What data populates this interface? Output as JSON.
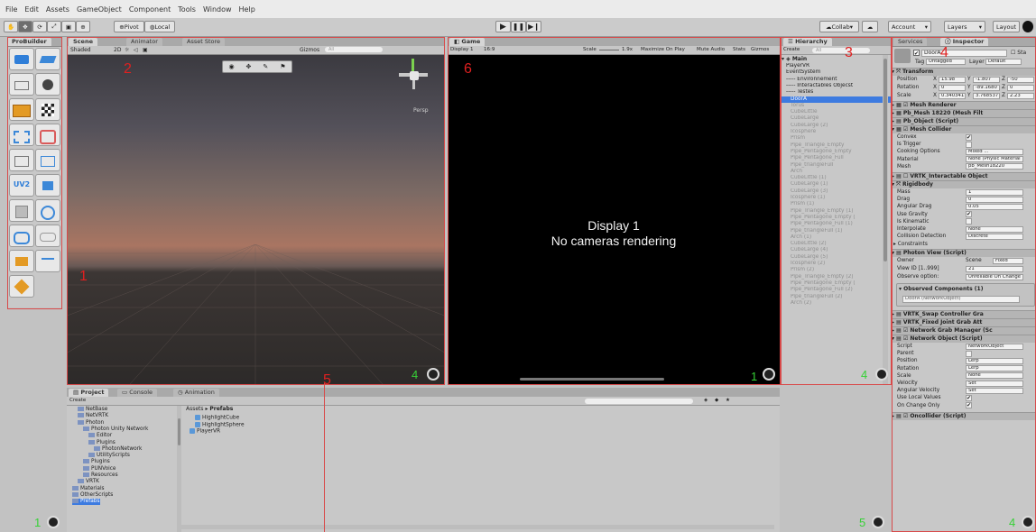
{
  "menu": [
    "File",
    "Edit",
    "Assets",
    "GameObject",
    "Component",
    "Tools",
    "Window",
    "Help"
  ],
  "toolbar": {
    "pivot": "Pivot",
    "local": "Local",
    "collab": "Collab",
    "account": "Account",
    "layers": "Layers",
    "layout": "Layout"
  },
  "probuilder": {
    "tab": "ProBuilder"
  },
  "scene": {
    "tabs": [
      "Scene",
      "Animator",
      "Asset Store"
    ],
    "shading": "Shaded",
    "mode2d": "2D",
    "gizmos": "Gizmos",
    "search": "All",
    "persp": "Persp"
  },
  "game": {
    "tab": "Game",
    "display": "Display 1",
    "aspect": "16:9",
    "scale_label": "Scale",
    "scale_value": "1.9x",
    "maximize": "Maximize On Play",
    "mute": "Mute Audio",
    "stats": "Stats",
    "gizmos": "Gizmos",
    "message_line1": "Display 1",
    "message_line2": "No cameras rendering"
  },
  "hierarchy": {
    "tab": "Hierarchy",
    "create": "Create",
    "search": "All",
    "scene": "Main",
    "items": [
      {
        "label": "PlayerVR",
        "indent": 1,
        "dim": false
      },
      {
        "label": "EventSystem",
        "indent": 1,
        "dim": false
      },
      {
        "label": "----- Environnement",
        "indent": 1,
        "dim": false
      },
      {
        "label": "----- Interactables Objecst",
        "indent": 1,
        "dim": false
      },
      {
        "label": "----- Testes",
        "indent": 1,
        "dim": false
      },
      {
        "label": "DoorA",
        "indent": 2,
        "dim": false,
        "selected": true
      },
      {
        "label": "Torus",
        "indent": 2,
        "dim": true
      },
      {
        "label": "CubeLittle",
        "indent": 2,
        "dim": true
      },
      {
        "label": "CubeLarge",
        "indent": 2,
        "dim": true
      },
      {
        "label": "CubeLarge (2)",
        "indent": 2,
        "dim": true
      },
      {
        "label": "Icosphere",
        "indent": 2,
        "dim": true
      },
      {
        "label": "Prism",
        "indent": 2,
        "dim": true
      },
      {
        "label": "Pipe_Triangle_Empty",
        "indent": 2,
        "dim": true
      },
      {
        "label": "Pipe_Pentagone_Empty",
        "indent": 2,
        "dim": true
      },
      {
        "label": "Pipe_Pentagone_Full",
        "indent": 2,
        "dim": true
      },
      {
        "label": "Pipe_triangleFull",
        "indent": 2,
        "dim": true
      },
      {
        "label": "Arch",
        "indent": 2,
        "dim": true
      },
      {
        "label": "CubeLittle (1)",
        "indent": 2,
        "dim": true
      },
      {
        "label": "CubeLarge (1)",
        "indent": 2,
        "dim": true
      },
      {
        "label": "CubeLarge (3)",
        "indent": 2,
        "dim": true
      },
      {
        "label": "Icosphere (1)",
        "indent": 2,
        "dim": true
      },
      {
        "label": "Prism (1)",
        "indent": 2,
        "dim": true
      },
      {
        "label": "Pipe_Triangle_Empty (1)",
        "indent": 2,
        "dim": true
      },
      {
        "label": "Pipe_Pentagone_Empty (",
        "indent": 2,
        "dim": true
      },
      {
        "label": "Pipe_Pentagone_Full (1)",
        "indent": 2,
        "dim": true
      },
      {
        "label": "Pipe_triangleFull (1)",
        "indent": 2,
        "dim": true
      },
      {
        "label": "Arch (1)",
        "indent": 2,
        "dim": true
      },
      {
        "label": "CubeLittle (2)",
        "indent": 2,
        "dim": true
      },
      {
        "label": "CubeLarge (4)",
        "indent": 2,
        "dim": true
      },
      {
        "label": "CubeLarge (5)",
        "indent": 2,
        "dim": true
      },
      {
        "label": "Icosphere (2)",
        "indent": 2,
        "dim": true
      },
      {
        "label": "Prism (2)",
        "indent": 2,
        "dim": true
      },
      {
        "label": "Pipe_Triangle_Empty (2)",
        "indent": 2,
        "dim": true
      },
      {
        "label": "Pipe_Pentagone_Empty (",
        "indent": 2,
        "dim": true
      },
      {
        "label": "Pipe_Pentagone_Full (2)",
        "indent": 2,
        "dim": true
      },
      {
        "label": "Pipe_triangleFull (2)",
        "indent": 2,
        "dim": true
      },
      {
        "label": "Arch (2)",
        "indent": 2,
        "dim": true
      }
    ]
  },
  "inspector": {
    "tabs": [
      "Services",
      "Inspector"
    ],
    "object_name": "DoorA",
    "static": "Sta",
    "tag_label": "Tag",
    "tag_value": "Untagged",
    "layer_label": "Layer",
    "layer_value": "Default",
    "transform": {
      "title": "Transform",
      "position": {
        "label": "Position",
        "x": "15.98",
        "y": "-1.807",
        "z": "-50"
      },
      "rotation": {
        "label": "Rotation",
        "x": "0",
        "y": "-89.1680",
        "z": "0"
      },
      "scale": {
        "label": "Scale",
        "x": "0.340341",
        "y": "3.768537",
        "z": "2.23"
      }
    },
    "mesh_renderer": "Mesh Renderer",
    "pb_mesh": "Pb_Mesh 18220 (Mesh Filt",
    "pb_object": "Pb_Object (Script)",
    "mesh_collider": {
      "title": "Mesh Collider",
      "rows": [
        {
          "label": "Convex",
          "value": "",
          "check": true
        },
        {
          "label": "Is Trigger",
          "value": "",
          "check": false
        },
        {
          "label": "Cooking Options",
          "value": "Mixed ..."
        },
        {
          "label": "Material",
          "value": "None (Physic Material"
        },
        {
          "label": "Mesh",
          "value": "pb_Mesh18220"
        }
      ]
    },
    "vrtk_interactable": "VRTK_Interactable Object",
    "rigidbody": {
      "title": "Rigidbody",
      "rows": [
        {
          "label": "Mass",
          "value": "1"
        },
        {
          "label": "Drag",
          "value": "0"
        },
        {
          "label": "Angular Drag",
          "value": "0.05"
        },
        {
          "label": "Use Gravity",
          "value": "",
          "check": true
        },
        {
          "label": "Is Kinematic",
          "value": "",
          "check": false
        },
        {
          "label": "Interpolate",
          "value": "None"
        },
        {
          "label": "Collision Detection",
          "value": "Discrete"
        }
      ],
      "constraints": "Constraints"
    },
    "photon_view": {
      "title": "Photon View (Script)",
      "owner_label": "Owner",
      "owner_value": "Scene",
      "owner_mode": "Fixed",
      "viewid_label": "View ID [1..999]",
      "viewid_value": "21",
      "observe_label": "Observe option:",
      "observe_value": "Unreliable On Change",
      "observed_title": "Observed Components (1)",
      "observed_item": "DoorA (NetworkObject)"
    },
    "vrtk_swap": "VRTK_Swap Controller Gra",
    "vrtk_fixed": "VRTK_Fixed Joint Grab Att",
    "network_grab": "Network Grab Manager (Sc",
    "network_object": {
      "title": "Network Object (Script)",
      "rows": [
        {
          "label": "Script",
          "value": "NetworkObject"
        },
        {
          "label": "Parent",
          "value": "",
          "check": false
        },
        {
          "label": "Position",
          "value": "Lerp"
        },
        {
          "label": "Rotation",
          "value": "Lerp"
        },
        {
          "label": "Scale",
          "value": "None"
        },
        {
          "label": "Velocity",
          "value": "Set"
        },
        {
          "label": "Angular Velocity",
          "value": "Set"
        },
        {
          "label": "Use Local Values",
          "value": "",
          "check": true
        },
        {
          "label": "On Change Only",
          "value": "",
          "check": true
        }
      ]
    },
    "oncollider": "Oncollider (Script)"
  },
  "project": {
    "tabs": [
      "Project",
      "Console",
      "Animation"
    ],
    "create": "Create",
    "breadcrumb_root": "Assets",
    "breadcrumb_current": "Prefabs",
    "tree": [
      {
        "label": "NetBase",
        "indent": 2
      },
      {
        "label": "NetVRTK",
        "indent": 2
      },
      {
        "label": "Photon",
        "indent": 2
      },
      {
        "label": "Photon Unity Network",
        "indent": 3
      },
      {
        "label": "Editor",
        "indent": 4
      },
      {
        "label": "Plugins",
        "indent": 4
      },
      {
        "label": "PhotonNetwork",
        "indent": 5
      },
      {
        "label": "UtilityScripts",
        "indent": 4
      },
      {
        "label": "Plugins",
        "indent": 3
      },
      {
        "label": "PUNVoice",
        "indent": 3
      },
      {
        "label": "Resources",
        "indent": 3
      },
      {
        "label": "VRTK",
        "indent": 2
      },
      {
        "label": "Materials",
        "indent": 1
      },
      {
        "label": "OtherScripts",
        "indent": 1
      },
      {
        "label": "Prefabs",
        "indent": 1
      }
    ],
    "assets": [
      "HighlightCube",
      "HighlightSphere",
      "PlayerVR"
    ]
  },
  "annotations": {
    "red": [
      "1",
      "2",
      "3",
      "4",
      "5",
      "6"
    ],
    "green": [
      "1",
      "4",
      "1",
      "4",
      "5",
      "4"
    ]
  }
}
